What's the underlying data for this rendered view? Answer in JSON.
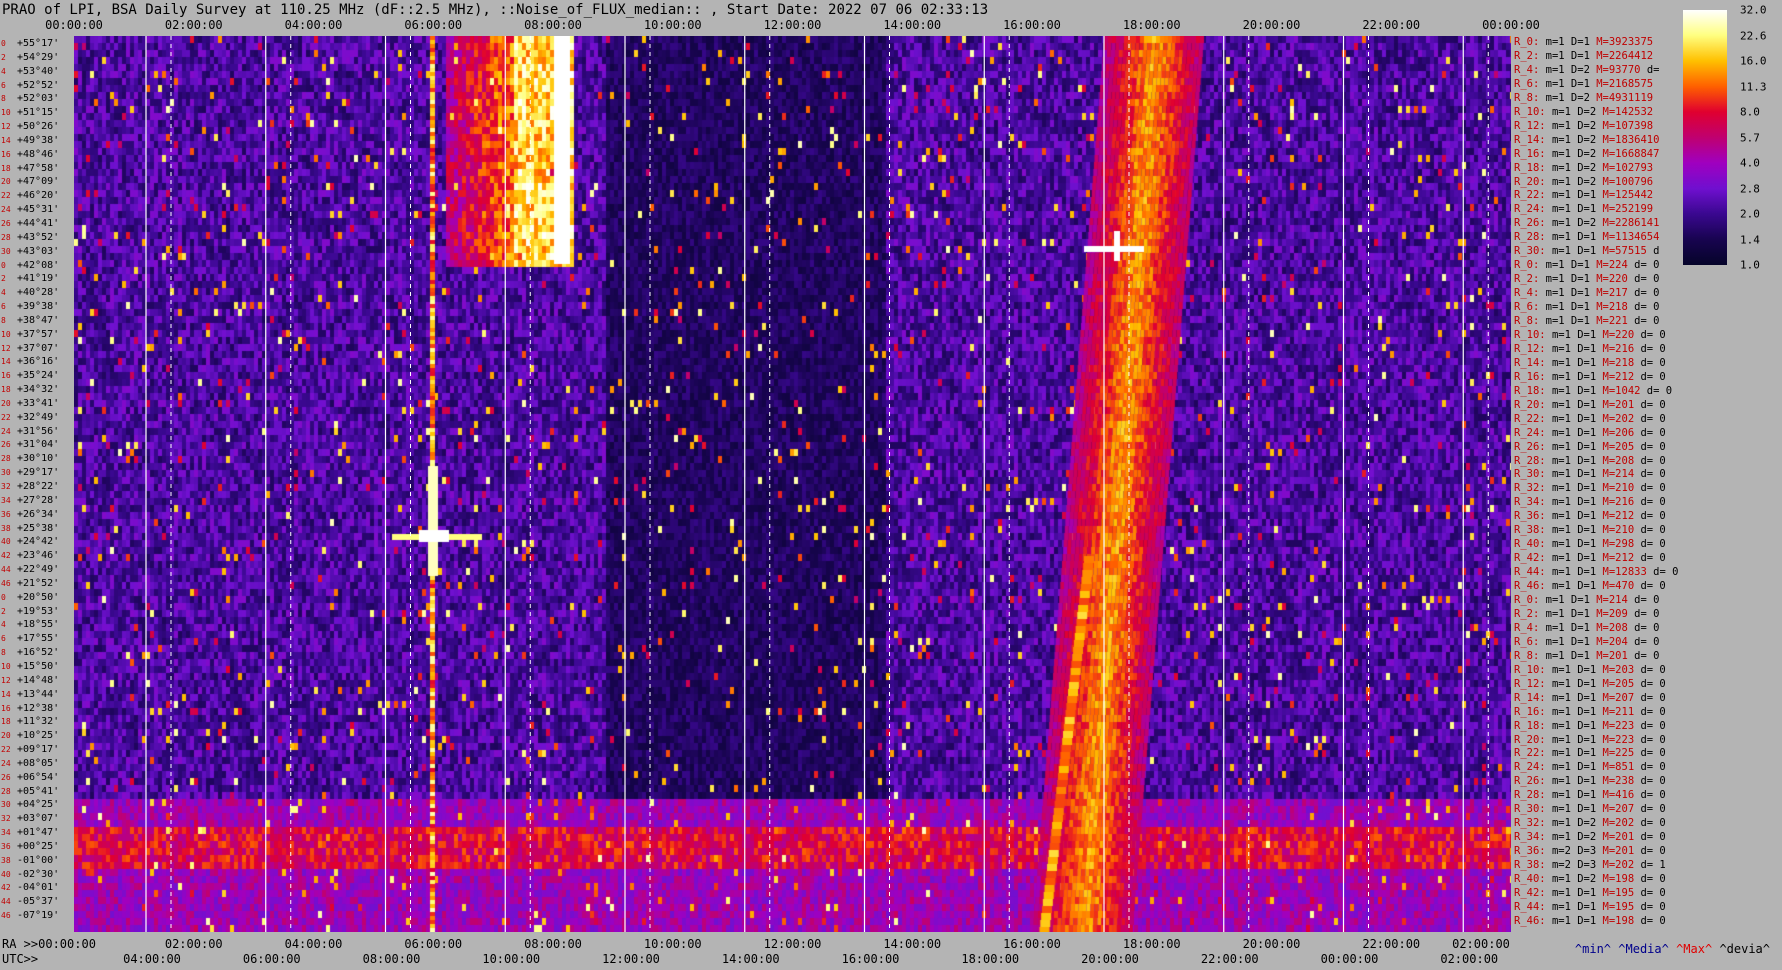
{
  "chart_data": {
    "type": "heatmap",
    "title": "PRAO of LPI, BSA Daily Survey at 110.25 MHz (dF::2.5 MHz), ::Noise_of_FLUX_median:: , Start Date: 2022 07 06 02:33:13",
    "top_time_ticks": [
      "00:00:00",
      "02:00:00",
      "04:00:00",
      "06:00:00",
      "08:00:00",
      "10:00:00",
      "12:00:00",
      "14:00:00",
      "16:00:00",
      "18:00:00",
      "20:00:00",
      "22:00:00",
      "00:00:00"
    ],
    "ra_label": "RA >>00:00:00",
    "ra_ticks": [
      "02:00:00",
      "04:00:00",
      "06:00:00",
      "08:00:00",
      "10:00:00",
      "12:00:00",
      "14:00:00",
      "16:00:00",
      "18:00:00",
      "20:00:00",
      "22:00:00",
      "02:00:00"
    ],
    "utc_label": "UTC>>",
    "utc_ticks": [
      "04:00:00",
      "06:00:00",
      "08:00:00",
      "10:00:00",
      "12:00:00",
      "14:00:00",
      "16:00:00",
      "18:00:00",
      "20:00:00",
      "22:00:00",
      "00:00:00",
      "02:00:00"
    ],
    "colorbar": {
      "ticks": [
        "32.0",
        "22.6",
        "16.0",
        "11.3",
        "8.0",
        "5.7",
        "4.0",
        "2.8",
        "2.0",
        "1.4",
        "1.0"
      ],
      "colors": [
        "#ffffff",
        "#ffff80",
        "#ffc000",
        "#ff6000",
        "#e00030",
        "#c00070",
        "#a000c0",
        "#7010d0",
        "#3a0890",
        "#180450",
        "#06042a"
      ]
    },
    "legend": [
      "^min^",
      "^Media^",
      "^Max^",
      "^devia^"
    ],
    "declinations": [
      "+55°17'",
      "+54°29'",
      "+53°40'",
      "+52°52'",
      "+52°03'",
      "+51°15'",
      "+50°26'",
      "+49°38'",
      "+48°46'",
      "+47°58'",
      "+47°09'",
      "+46°20'",
      "+45°31'",
      "+44°41'",
      "+43°52'",
      "+43°03'",
      "+42°08'",
      "+41°19'",
      "+40°28'",
      "+39°38'",
      "+38°47'",
      "+37°57'",
      "+37°07'",
      "+36°16'",
      "+35°24'",
      "+34°32'",
      "+33°41'",
      "+32°49'",
      "+31°56'",
      "+31°04'",
      "+30°10'",
      "+29°17'",
      "+28°22'",
      "+27°28'",
      "+26°34'",
      "+25°38'",
      "+24°42'",
      "+23°46'",
      "+22°49'",
      "+21°52'",
      "+20°50'",
      "+19°53'",
      "+18°55'",
      "+17°55'",
      "+16°52'",
      "+15°50'",
      "+14°48'",
      "+13°44'",
      "+12°38'",
      "+11°32'",
      "+10°25'",
      "+09°17'",
      "+08°05'",
      "+06°54'",
      "+05°41'",
      "+04°25'",
      "+03°07'",
      "+01°47'",
      "+00°25'",
      "-01°00'",
      "-02°30'",
      "-04°01'",
      "-05°37'",
      "-07°19'"
    ],
    "dec_indices": [
      "0",
      "2",
      "4",
      "6",
      "8",
      "10",
      "12",
      "14",
      "16",
      "18",
      "20",
      "22",
      "24",
      "26",
      "28",
      "30",
      "0",
      "2",
      "4",
      "6",
      "8",
      "10",
      "12",
      "14",
      "16",
      "18",
      "20",
      "22",
      "24",
      "26",
      "28",
      "30",
      "32",
      "34",
      "36",
      "38",
      "40",
      "42",
      "44",
      "46",
      "0",
      "2",
      "4",
      "6",
      "8",
      "10",
      "12",
      "14",
      "16",
      "18",
      "20",
      "22",
      "24",
      "26",
      "28",
      "30",
      "32",
      "34",
      "36",
      "38",
      "40",
      "42",
      "44",
      "46"
    ],
    "receivers": [
      {
        "r": "R_0:",
        "m": "m=1",
        "d": "D=1",
        "M": "M=3923375",
        "x": ""
      },
      {
        "r": "R_2:",
        "m": "m=1",
        "d": "D=1",
        "M": "M=2264412",
        "x": ""
      },
      {
        "r": "R_4:",
        "m": "m=1",
        "d": "D=2",
        "M": "M=93770",
        "x": "d="
      },
      {
        "r": "R_6:",
        "m": "m=1",
        "d": "D=1",
        "M": "M=2168575",
        "x": ""
      },
      {
        "r": "R_8:",
        "m": "m=1",
        "d": "D=2",
        "M": "M=4931119",
        "x": ""
      },
      {
        "r": "R_10:",
        "m": "m=1",
        "d": "D=2",
        "M": "M=142532",
        "x": ""
      },
      {
        "r": "R_12:",
        "m": "m=1",
        "d": "D=2",
        "M": "M=107398",
        "x": ""
      },
      {
        "r": "R_14:",
        "m": "m=1",
        "d": "D=2",
        "M": "M=1836410",
        "x": ""
      },
      {
        "r": "R_16:",
        "m": "m=1",
        "d": "D=2",
        "M": "M=1668847",
        "x": ""
      },
      {
        "r": "R_18:",
        "m": "m=1",
        "d": "D=2",
        "M": "M=102793",
        "x": ""
      },
      {
        "r": "R_20:",
        "m": "m=1",
        "d": "D=2",
        "M": "M=100796",
        "x": ""
      },
      {
        "r": "R_22:",
        "m": "m=1",
        "d": "D=1",
        "M": "M=125442",
        "x": ""
      },
      {
        "r": "R_24:",
        "m": "m=1",
        "d": "D=1",
        "M": "M=252199",
        "x": ""
      },
      {
        "r": "R_26:",
        "m": "m=1",
        "d": "D=2",
        "M": "M=2286141",
        "x": ""
      },
      {
        "r": "R_28:",
        "m": "m=1",
        "d": "D=1",
        "M": "M=1134654",
        "x": ""
      },
      {
        "r": "R_30:",
        "m": "m=1",
        "d": "D=1",
        "M": "M=57515",
        "x": "d"
      },
      {
        "r": "R_0:",
        "m": "m=1",
        "d": "D=1",
        "M": "M=224",
        "x": "d= 0"
      },
      {
        "r": "R_2:",
        "m": "m=1",
        "d": "D=1",
        "M": "M=220",
        "x": "d= 0"
      },
      {
        "r": "R_4:",
        "m": "m=1",
        "d": "D=1",
        "M": "M=217",
        "x": "d= 0"
      },
      {
        "r": "R_6:",
        "m": "m=1",
        "d": "D=1",
        "M": "M=218",
        "x": "d= 0"
      },
      {
        "r": "R_8:",
        "m": "m=1",
        "d": "D=1",
        "M": "M=221",
        "x": "d= 0"
      },
      {
        "r": "R_10:",
        "m": "m=1",
        "d": "D=1",
        "M": "M=220",
        "x": "d= 0"
      },
      {
        "r": "R_12:",
        "m": "m=1",
        "d": "D=1",
        "M": "M=216",
        "x": "d= 0"
      },
      {
        "r": "R_14:",
        "m": "m=1",
        "d": "D=1",
        "M": "M=218",
        "x": "d= 0"
      },
      {
        "r": "R_16:",
        "m": "m=1",
        "d": "D=1",
        "M": "M=212",
        "x": "d= 0"
      },
      {
        "r": "R_18:",
        "m": "m=1",
        "d": "D=1",
        "M": "M=1042",
        "x": "d= 0"
      },
      {
        "r": "R_20:",
        "m": "m=1",
        "d": "D=1",
        "M": "M=201",
        "x": "d= 0"
      },
      {
        "r": "R_22:",
        "m": "m=1",
        "d": "D=1",
        "M": "M=202",
        "x": "d= 0"
      },
      {
        "r": "R_24:",
        "m": "m=1",
        "d": "D=1",
        "M": "M=206",
        "x": "d= 0"
      },
      {
        "r": "R_26:",
        "m": "m=1",
        "d": "D=1",
        "M": "M=205",
        "x": "d= 0"
      },
      {
        "r": "R_28:",
        "m": "m=1",
        "d": "D=1",
        "M": "M=208",
        "x": "d= 0"
      },
      {
        "r": "R_30:",
        "m": "m=1",
        "d": "D=1",
        "M": "M=214",
        "x": "d= 0"
      },
      {
        "r": "R_32:",
        "m": "m=1",
        "d": "D=1",
        "M": "M=210",
        "x": "d= 0"
      },
      {
        "r": "R_34:",
        "m": "m=1",
        "d": "D=1",
        "M": "M=216",
        "x": "d= 0"
      },
      {
        "r": "R_36:",
        "m": "m=1",
        "d": "D=1",
        "M": "M=212",
        "x": "d= 0"
      },
      {
        "r": "R_38:",
        "m": "m=1",
        "d": "D=1",
        "M": "M=210",
        "x": "d= 0"
      },
      {
        "r": "R_40:",
        "m": "m=1",
        "d": "D=1",
        "M": "M=298",
        "x": "d= 0"
      },
      {
        "r": "R_42:",
        "m": "m=1",
        "d": "D=1",
        "M": "M=212",
        "x": "d= 0"
      },
      {
        "r": "R_44:",
        "m": "m=1",
        "d": "D=1",
        "M": "M=12833",
        "x": "d= 0"
      },
      {
        "r": "R_46:",
        "m": "m=1",
        "d": "D=1",
        "M": "M=470",
        "x": "d= 0"
      },
      {
        "r": "R_0:",
        "m": "m=1",
        "d": "D=1",
        "M": "M=214",
        "x": "d= 0"
      },
      {
        "r": "R_2:",
        "m": "m=1",
        "d": "D=1",
        "M": "M=209",
        "x": "d= 0"
      },
      {
        "r": "R_4:",
        "m": "m=1",
        "d": "D=1",
        "M": "M=208",
        "x": "d= 0"
      },
      {
        "r": "R_6:",
        "m": "m=1",
        "d": "D=1",
        "M": "M=204",
        "x": "d= 0"
      },
      {
        "r": "R_8:",
        "m": "m=1",
        "d": "D=1",
        "M": "M=201",
        "x": "d= 0"
      },
      {
        "r": "R_10:",
        "m": "m=1",
        "d": "D=1",
        "M": "M=203",
        "x": "d= 0"
      },
      {
        "r": "R_12:",
        "m": "m=1",
        "d": "D=1",
        "M": "M=205",
        "x": "d= 0"
      },
      {
        "r": "R_14:",
        "m": "m=1",
        "d": "D=1",
        "M": "M=207",
        "x": "d= 0"
      },
      {
        "r": "R_16:",
        "m": "m=1",
        "d": "D=1",
        "M": "M=211",
        "x": "d= 0"
      },
      {
        "r": "R_18:",
        "m": "m=1",
        "d": "D=1",
        "M": "M=223",
        "x": "d= 0"
      },
      {
        "r": "R_20:",
        "m": "m=1",
        "d": "D=1",
        "M": "M=223",
        "x": "d= 0"
      },
      {
        "r": "R_22:",
        "m": "m=1",
        "d": "D=1",
        "M": "M=225",
        "x": "d= 0"
      },
      {
        "r": "R_24:",
        "m": "m=1",
        "d": "D=1",
        "M": "M=851",
        "x": "d= 0"
      },
      {
        "r": "R_26:",
        "m": "m=1",
        "d": "D=1",
        "M": "M=238",
        "x": "d= 0"
      },
      {
        "r": "R_28:",
        "m": "m=1",
        "d": "D=1",
        "M": "M=416",
        "x": "d= 0"
      },
      {
        "r": "R_30:",
        "m": "m=1",
        "d": "D=1",
        "M": "M=207",
        "x": "d= 0"
      },
      {
        "r": "R_32:",
        "m": "m=1",
        "d": "D=2",
        "M": "M=202",
        "x": "d= 0"
      },
      {
        "r": "R_34:",
        "m": "m=1",
        "d": "D=2",
        "M": "M=201",
        "x": "d= 0"
      },
      {
        "r": "R_36:",
        "m": "m=2",
        "d": "D=3",
        "M": "M=201",
        "x": "d= 0"
      },
      {
        "r": "R_38:",
        "m": "m=2",
        "d": "D=3",
        "M": "M=202",
        "x": "d= 1"
      },
      {
        "r": "R_40:",
        "m": "m=1",
        "d": "D=2",
        "M": "M=198",
        "x": "d= 0"
      },
      {
        "r": "R_42:",
        "m": "m=1",
        "d": "D=1",
        "M": "M=195",
        "x": "d= 0"
      },
      {
        "r": "R_44:",
        "m": "m=1",
        "d": "D=1",
        "M": "M=195",
        "x": "d= 0"
      },
      {
        "r": "R_46:",
        "m": "m=1",
        "d": "D=1",
        "M": "M=198",
        "x": "d= 0"
      }
    ]
  }
}
